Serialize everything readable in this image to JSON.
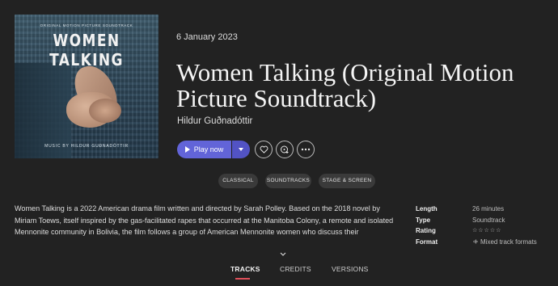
{
  "cover": {
    "top_text": "ORIGINAL MOTION PICTURE SOUNDTRACK",
    "title": "WOMEN TALKING",
    "music_by": "MUSIC BY HILDUR GUÐNADÓTTIR"
  },
  "release_date": "6 January 2023",
  "album_title": "Women Talking (Original Motion Picture Soundtrack)",
  "artist": "Hildur Guðnadóttir",
  "actions": {
    "play_label": "Play now",
    "accent_color": "#6264d8"
  },
  "tags": [
    "CLASSICAL",
    "SOUNDTRACKS",
    "STAGE & SCREEN"
  ],
  "description": "Women Talking is a 2022 American drama film written and directed by Sarah Polley. Based on the 2018 novel by Miriam Toews, itself inspired by the gas-facilitated rapes that occurred at the Manitoba Colony, a remote and isolated Mennonite community in Bolivia, the film follows a group of American Mennonite women who discuss their",
  "meta": {
    "length_label": "Length",
    "length_value": "26 minutes",
    "type_label": "Type",
    "type_value": "Soundtrack",
    "rating_label": "Rating",
    "rating_value": "☆☆☆☆☆",
    "format_label": "Format",
    "format_value": "Mixed track formats"
  },
  "tabs": [
    "TRACKS",
    "CREDITS",
    "VERSIONS"
  ],
  "active_tab": "TRACKS"
}
